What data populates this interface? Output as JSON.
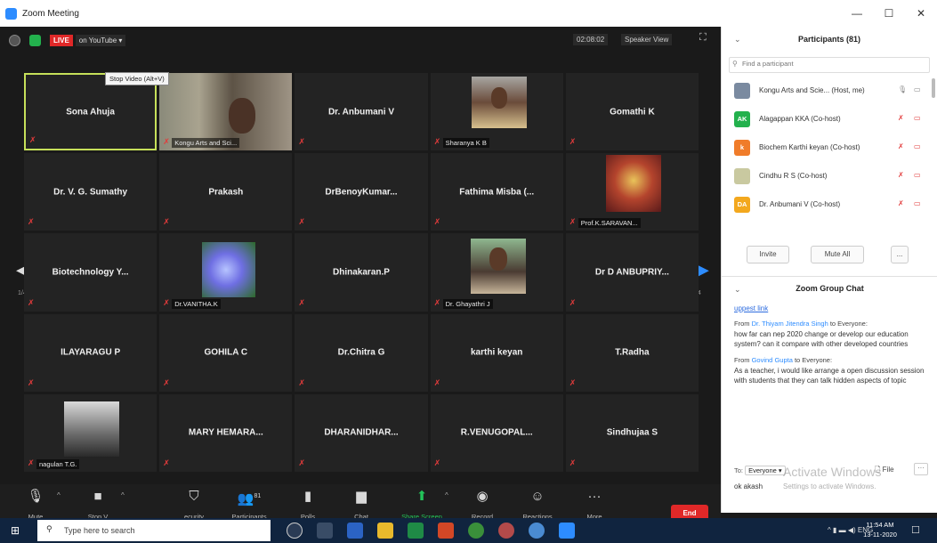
{
  "window": {
    "title": "Zoom Meeting",
    "minimize": "—",
    "maximize": "☐",
    "close": "✕"
  },
  "topbar": {
    "live": "LIVE",
    "platform": "on YouTube ▾",
    "timer": "02:08:02",
    "view": "Speaker View",
    "fullscreen_icon": "⛶"
  },
  "grid": {
    "page_left": "1/4",
    "page_right": "1/4",
    "arrow_left": "◀",
    "arrow_right": "▶",
    "tiles": [
      {
        "name": "Sona Ahuja",
        "label": "",
        "video": "",
        "active": true
      },
      {
        "name": "",
        "label": "Kongu Arts and Sci...",
        "video": "room",
        "active": false
      },
      {
        "name": "Dr. Anbumani V",
        "label": "",
        "video": "",
        "active": false
      },
      {
        "name": "",
        "label": "Sharanya K B",
        "video": "photo1",
        "active": false
      },
      {
        "name": "Gomathi K",
        "label": "",
        "video": "",
        "active": false
      },
      {
        "name": "Dr. V. G. Sumathy",
        "label": "",
        "video": "",
        "active": false
      },
      {
        "name": "Prakash",
        "label": "",
        "video": "",
        "active": false
      },
      {
        "name": "DrBenoyKumar...",
        "label": "",
        "video": "",
        "active": false
      },
      {
        "name": "Fathima Misba (...",
        "label": "",
        "video": "",
        "active": false
      },
      {
        "name": "",
        "label": "Prof.K.SARAVAN...",
        "video": "deity",
        "active": false
      },
      {
        "name": "Biotechnology Y...",
        "label": "",
        "video": "",
        "active": false
      },
      {
        "name": "",
        "label": "Dr.VANITHA.K",
        "video": "flower",
        "active": false
      },
      {
        "name": "Dhinakaran.P",
        "label": "",
        "video": "",
        "active": false
      },
      {
        "name": "",
        "label": "Dr. Ghayathri J",
        "video": "photo2",
        "active": false
      },
      {
        "name": "Dr D ANBUPRIY...",
        "label": "",
        "video": "",
        "active": false
      },
      {
        "name": "ILAYARAGU P",
        "label": "",
        "video": "",
        "active": false
      },
      {
        "name": "GOHILA C",
        "label": "",
        "video": "",
        "active": false
      },
      {
        "name": "Dr.Chitra G",
        "label": "",
        "video": "",
        "active": false
      },
      {
        "name": "karthi keyan",
        "label": "",
        "video": "",
        "active": false
      },
      {
        "name": "T.Radha",
        "label": "",
        "video": "",
        "active": false
      },
      {
        "name": "",
        "label": "nagulan T.G.",
        "video": "bike",
        "active": false
      },
      {
        "name": "MARY HEMARA...",
        "label": "",
        "video": "",
        "active": false
      },
      {
        "name": "DHARANIDHAR...",
        "label": "",
        "video": "",
        "active": false
      },
      {
        "name": "R.VENUGOPAL...",
        "label": "",
        "video": "",
        "active": false
      },
      {
        "name": "Sindhujaa S",
        "label": "",
        "video": "",
        "active": false
      }
    ]
  },
  "controls": {
    "mute": {
      "label": "Mute",
      "icon": "🎙"
    },
    "stop_video": {
      "label": "Stop V",
      "icon": "■"
    },
    "security": {
      "label": "ecurity",
      "icon": "⛉"
    },
    "participants": {
      "label": "Participants",
      "icon": "👥",
      "count": "81"
    },
    "polls": {
      "label": "Polls",
      "icon": "▮"
    },
    "chat": {
      "label": "Chat",
      "icon": "▆"
    },
    "share_screen": {
      "label": "Share Screen",
      "icon": "⬆"
    },
    "record": {
      "label": "Record",
      "icon": "◉"
    },
    "reactions": {
      "label": "Reactions",
      "icon": "☺"
    },
    "more": {
      "label": "More",
      "icon": "···"
    },
    "end": "End",
    "tooltip": "Stop Video (Alt+V)",
    "caret": "^"
  },
  "participants_panel": {
    "title": "Participants (81)",
    "search_placeholder": "Find a participant",
    "items": [
      {
        "name": "Kongu Arts and Scie... (Host, me)",
        "initials": "",
        "color": "#7a8aa0",
        "host": true
      },
      {
        "name": "Alagappan KKA (Co-host)",
        "initials": "AK",
        "color": "#23b14d",
        "host": false
      },
      {
        "name": "Biochem Karthi keyan (Co-host)",
        "initials": "k",
        "color": "#f07c2a",
        "host": false
      },
      {
        "name": "Cindhu R S (Co-host)",
        "initials": "",
        "color": "#c9c9a0",
        "host": false
      },
      {
        "name": "Dr. Anbumani V (Co-host)",
        "initials": "DA",
        "color": "#f3a81e",
        "host": false
      }
    ],
    "invite": "Invite",
    "mute_all": "Mute All",
    "more": "..."
  },
  "chat_panel": {
    "title": "Zoom Group Chat",
    "link_text": "uppest link",
    "messages": [
      {
        "from_prefix": "From ",
        "sender": "Dr. Thiyam Jitendra Singh",
        "to_suffix": " to Everyone:",
        "text": "how far can nep 2020 change or develop our education system? can it compare with other developed countries"
      },
      {
        "from_prefix": "From ",
        "sender": "Govind Gupta",
        "to_suffix": " to Everyone:",
        "text": "As a teacher, i would like arrange a open discussion session with students that they can talk hidden aspects of topic"
      }
    ],
    "to_label": "To:",
    "to_value": "Everyone ▾",
    "file": "File",
    "more": "···",
    "input_value": "ok akash",
    "watermark_title": "Activate Windows",
    "watermark_sub": "Settings to activate Windows."
  },
  "taskbar": {
    "start": "⊞",
    "search_placeholder": "Type here to search",
    "tray": "^ ▮ ▬ ◀) ENG",
    "time": "11:54 AM",
    "date": "13-11-2020",
    "notif": "☐"
  }
}
